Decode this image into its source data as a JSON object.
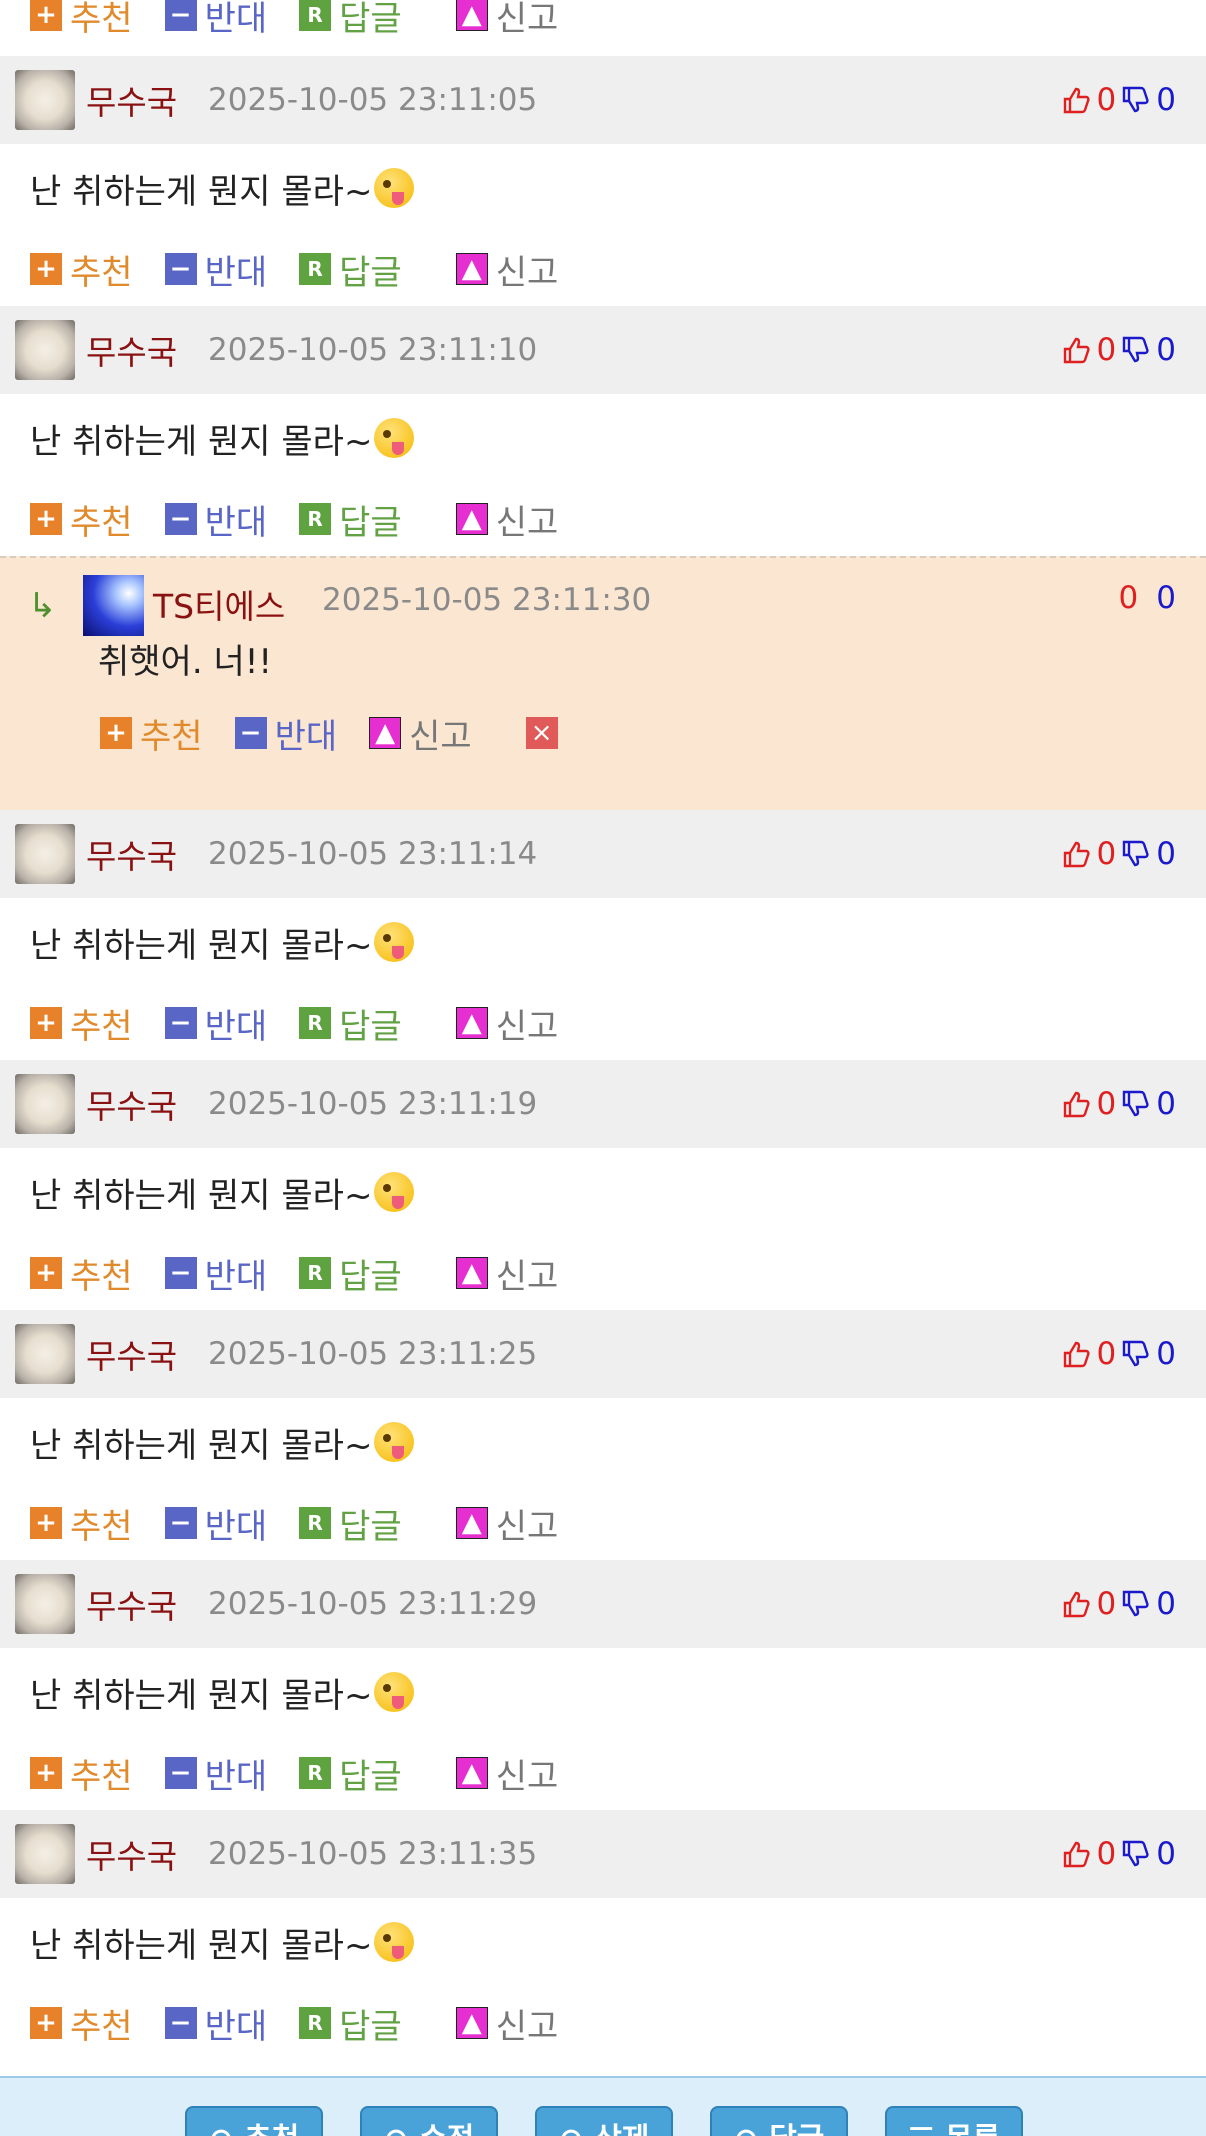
{
  "labels": {
    "recommend": "추천",
    "oppose": "반대",
    "reply": "답글",
    "report": "신고"
  },
  "icons": {
    "recommend": "plus-icon",
    "oppose": "minus-icon",
    "reply": "r-icon",
    "report": "siren-icon",
    "up": "thumbs-up-icon",
    "down": "thumbs-down-icon",
    "reply_arrow": "reply-arrow-icon",
    "delete": "close-icon"
  },
  "comments": [
    {
      "nick": "무수국",
      "date": "2025-10-05 23:11:05",
      "up": "0",
      "down": "0",
      "text": "난 취하는게 뭔지 몰라~"
    },
    {
      "nick": "무수국",
      "date": "2025-10-05 23:11:10",
      "up": "0",
      "down": "0",
      "text": "난 취하는게 뭔지 몰라~"
    },
    {
      "nick": "무수국",
      "date": "2025-10-05 23:11:14",
      "up": "0",
      "down": "0",
      "text": "난 취하는게 뭔지 몰라~"
    },
    {
      "nick": "무수국",
      "date": "2025-10-05 23:11:19",
      "up": "0",
      "down": "0",
      "text": "난 취하는게 뭔지 몰라~"
    },
    {
      "nick": "무수국",
      "date": "2025-10-05 23:11:25",
      "up": "0",
      "down": "0",
      "text": "난 취하는게 뭔지 몰라~"
    },
    {
      "nick": "무수국",
      "date": "2025-10-05 23:11:29",
      "up": "0",
      "down": "0",
      "text": "난 취하는게 뭔지 몰라~"
    },
    {
      "nick": "무수국",
      "date": "2025-10-05 23:11:35",
      "up": "0",
      "down": "0",
      "text": "난 취하는게 뭔지 몰라~"
    }
  ],
  "reply": {
    "arrow": "↳",
    "nick": "TS티에스",
    "date": "2025-10-05 23:11:30",
    "up": "0",
    "down": "0",
    "text": "취햇어. 너!!",
    "delete": "×"
  },
  "bottom_buttons": [
    "⊙ 추천",
    "⊙ 수정",
    "⊙ 삭제",
    "⊙ 답글",
    "☰ 목록"
  ],
  "colors": {
    "nick": "#8a1111",
    "date": "#8a8a8a",
    "reply_bg": "#fae6d1",
    "header_bg": "#efefef",
    "up": "#e02020",
    "down": "#1a1acc"
  }
}
